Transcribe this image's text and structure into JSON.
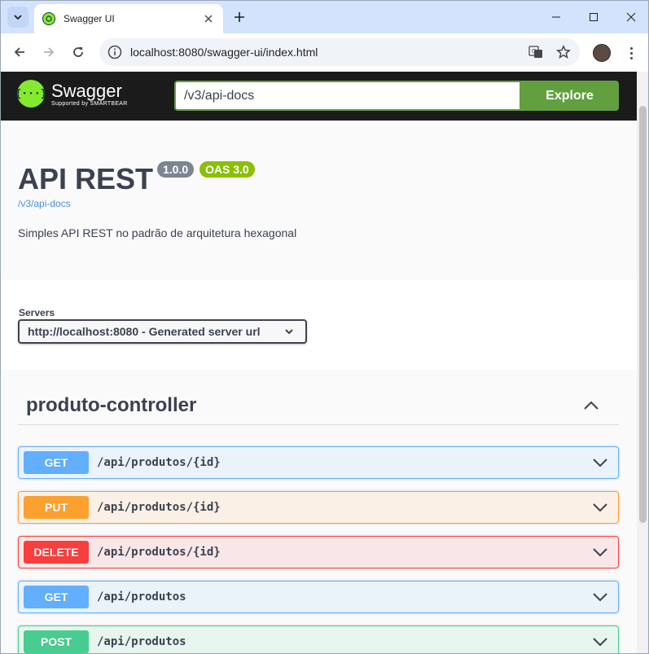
{
  "browser": {
    "tab_title": "Swagger UI",
    "url": "localhost:8080/swagger-ui/index.html"
  },
  "swagger": {
    "brand": "Swagger",
    "brand_sub": "Supported by SMARTBEAR",
    "spec_url": "/v3/api-docs",
    "explore_label": "Explore"
  },
  "info": {
    "title": "API REST",
    "version": "1.0.0",
    "oas": "OAS 3.0",
    "link": "/v3/api-docs",
    "description": "Simples API REST no padrão de arquitetura hexagonal"
  },
  "servers": {
    "label": "Servers",
    "selected": "http://localhost:8080 - Generated server url"
  },
  "tag": {
    "name": "produto-controller"
  },
  "operations": [
    {
      "method": "GET",
      "path": "/api/produtos/{id}"
    },
    {
      "method": "PUT",
      "path": "/api/produtos/{id}"
    },
    {
      "method": "DELETE",
      "path": "/api/produtos/{id}"
    },
    {
      "method": "GET",
      "path": "/api/produtos"
    },
    {
      "method": "POST",
      "path": "/api/produtos"
    }
  ],
  "colors": {
    "get": "#61affe",
    "put": "#fca130",
    "delete": "#f93e3e",
    "post": "#49cc90",
    "swagger_green": "#85ea2d",
    "explore_green": "#62a03f"
  }
}
